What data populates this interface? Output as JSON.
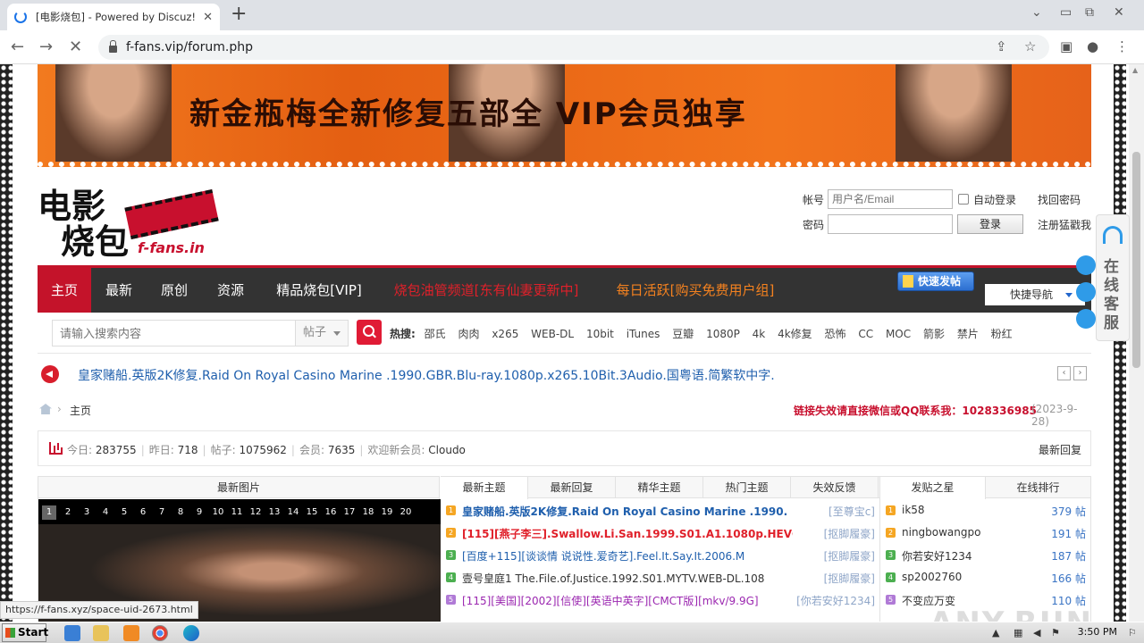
{
  "browser": {
    "tab_title": "[电影烧包] - Powered by Discuz!",
    "url": "f-fans.vip/forum.php",
    "new_tab": "+",
    "tab_close": "✕"
  },
  "banner": {
    "text": "新金瓶梅全新修复五部全 VIP会员独享"
  },
  "logo": {
    "line1": "电影",
    "line2": "烧包",
    "domain": "f-fans.in"
  },
  "login": {
    "account_label": "帐号",
    "account_placeholder": "用户名/Email",
    "password_label": "密码",
    "auto_login": "自动登录",
    "forgot": "找回密码",
    "login_btn": "登录",
    "register": "注册猛戳我"
  },
  "nav": {
    "items": [
      {
        "label": "主页"
      },
      {
        "label": "最新"
      },
      {
        "label": "原创"
      },
      {
        "label": "资源"
      },
      {
        "label": "精品烧包[VIP]"
      },
      {
        "label": "烧包油管频道[东有仙妻更新中]"
      },
      {
        "label": "每日活跃[购买免费用户组]"
      }
    ],
    "quick_post": "快速发帖",
    "quick_nav": "快捷导航"
  },
  "search": {
    "placeholder": "请输入搜索内容",
    "type": "帖子",
    "hot_label": "热搜:",
    "hot_terms": [
      "邵氏",
      "肉肉",
      "x265",
      "WEB-DL",
      "10bit",
      "iTunes",
      "豆瓣",
      "1080P",
      "4k",
      "4k修复",
      "恐怖",
      "CC",
      "MOC",
      "箭影",
      "禁片",
      "粉红"
    ]
  },
  "announcement": {
    "text": "皇家赌船.英版2K修复.Raid On Royal Casino Marine .1990.GBR.Blu-ray.1080p.x265.10Bit.3Audio.国粤语.简繁软中字."
  },
  "breadcrumb": {
    "current": "主页",
    "contact": "链接失效请直接微信或QQ联系我：1028336985",
    "date": "(2023-9-28)"
  },
  "stats": {
    "today_label": "今日:",
    "today": "283755",
    "yesterday_label": "昨日:",
    "yesterday": "718",
    "posts_label": "帖子:",
    "posts": "1075962",
    "members_label": "会员:",
    "members": "7635",
    "welcome_label": "欢迎新会员:",
    "welcome": "Cloudo",
    "latest_reply": "最新回复"
  },
  "pics": {
    "header": "最新图片",
    "numbers": [
      "1",
      "2",
      "3",
      "4",
      "5",
      "6",
      "7",
      "8",
      "9",
      "10",
      "11",
      "12",
      "13",
      "14",
      "15",
      "16",
      "17",
      "18",
      "19",
      "20"
    ],
    "active": 1
  },
  "threads": {
    "tabs": [
      "最新主题",
      "最新回复",
      "精华主题",
      "热门主题",
      "失效反馈"
    ],
    "rows": [
      {
        "n": "1",
        "title": "皇家赌船.英版2K修复.Raid On Royal Casino Marine .1990.",
        "author": "[至尊宝c]",
        "color": "#1f5fad",
        "badge": "#f5a623",
        "bold": true
      },
      {
        "n": "2",
        "title": "[115][燕子李三].Swallow.Li.San.1999.S01.A1.1080p.HEVC.",
        "author": "[抠脚履豪]",
        "color": "#e0202a",
        "badge": "#f5a623",
        "bold": true
      },
      {
        "n": "3",
        "title": "[百度+115][谈谈情 说说性.爱奇艺].Feel.It.Say.It.2006.M",
        "author": "[抠脚履豪]",
        "color": "#1f5fad",
        "badge": "#4caf50",
        "bold": false
      },
      {
        "n": "4",
        "title": "壹号皇庭1 The.File.of.Justice.1992.S01.MYTV.WEB-DL.108",
        "author": "[抠脚履豪]",
        "color": "#333333",
        "badge": "#4caf50",
        "bold": false
      },
      {
        "n": "5",
        "title": "[115][美国][2002][信使][英语中英字][CMCT版][mkv/9.9G]",
        "author": "[你若安好1234]",
        "color": "#9b27b0",
        "badge": "#b07ad6",
        "bold": false
      }
    ]
  },
  "stars": {
    "tabs": [
      "发贴之星",
      "在线排行"
    ],
    "rows": [
      {
        "n": "1",
        "name": "ik58",
        "count": "379 帖",
        "badge": "#f5a623"
      },
      {
        "n": "2",
        "name": "ningbowangpo",
        "count": "191 帖",
        "badge": "#f5a623"
      },
      {
        "n": "3",
        "name": "你若安好1234",
        "count": "187 帖",
        "badge": "#4caf50"
      },
      {
        "n": "4",
        "name": "sp2002760",
        "count": "166 帖",
        "badge": "#4caf50"
      },
      {
        "n": "5",
        "name": "不变应万变",
        "count": "110 帖",
        "badge": "#b07ad6"
      }
    ]
  },
  "service": {
    "text": "在线客服"
  },
  "status_link": "https://f-fans.xyz/space-uid-2673.html",
  "watermark": "ANY.RUN",
  "taskbar": {
    "start": "Start",
    "time": "3:50 PM"
  }
}
